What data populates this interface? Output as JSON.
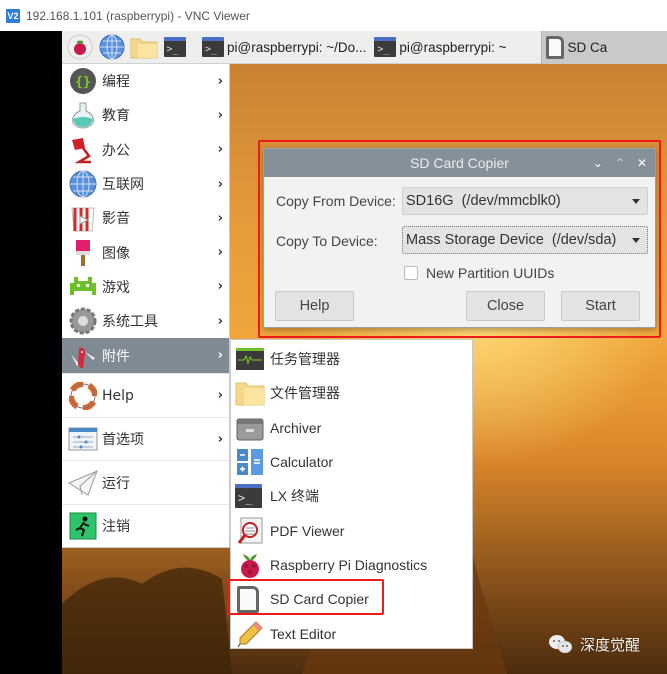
{
  "vnc": {
    "logo": "V2",
    "title": "192.168.1.101 (raspberrypi) - VNC Viewer"
  },
  "taskbar": {
    "launchers": [
      {
        "icon": "raspberry-menu-icon"
      },
      {
        "icon": "web-browser-icon"
      },
      {
        "icon": "file-manager-icon"
      },
      {
        "icon": "terminal-icon"
      }
    ],
    "tasks": [
      {
        "icon": "terminal-icon",
        "label": "pi@raspberrypi: ~/Do..."
      },
      {
        "icon": "terminal-icon",
        "label": "pi@raspberrypi: ~"
      },
      {
        "icon": "sd-card-icon",
        "label": "SD Ca",
        "active": true
      }
    ]
  },
  "main_menu": {
    "items": [
      {
        "label": "编程",
        "icon": "programming-icon",
        "submenu": true
      },
      {
        "label": "教育",
        "icon": "education-icon",
        "submenu": true
      },
      {
        "label": "办公",
        "icon": "office-icon",
        "submenu": true
      },
      {
        "label": "互联网",
        "icon": "internet-icon",
        "submenu": true
      },
      {
        "label": "影音",
        "icon": "media-icon",
        "submenu": true
      },
      {
        "label": "图像",
        "icon": "graphics-icon",
        "submenu": true
      },
      {
        "label": "游戏",
        "icon": "games-icon",
        "submenu": true
      },
      {
        "label": "系统工具",
        "icon": "system-tools-icon",
        "submenu": true
      },
      {
        "label": "附件",
        "icon": "accessories-icon",
        "submenu": true,
        "selected": true
      },
      {
        "label": "Help",
        "icon": "help-icon",
        "submenu": true
      },
      {
        "label": "首选项",
        "icon": "preferences-icon",
        "submenu": true
      },
      {
        "label": "运行",
        "icon": "run-icon",
        "submenu": false
      },
      {
        "label": "注销",
        "icon": "logout-icon",
        "submenu": false
      }
    ],
    "chevron": "›"
  },
  "sub_menu": {
    "items": [
      {
        "label": "任务管理器",
        "icon": "task-manager-icon"
      },
      {
        "label": "文件管理器",
        "icon": "file-manager-icon"
      },
      {
        "label": "Archiver",
        "icon": "archiver-icon"
      },
      {
        "label": "Calculator",
        "icon": "calculator-icon"
      },
      {
        "label": "LX 终端",
        "icon": "terminal-icon"
      },
      {
        "label": "PDF Viewer",
        "icon": "pdf-viewer-icon"
      },
      {
        "label": "Raspberry Pi Diagnostics",
        "icon": "raspberry-icon"
      },
      {
        "label": "SD Card Copier",
        "icon": "sd-card-icon",
        "highlighted": true
      },
      {
        "label": "Text Editor",
        "icon": "text-editor-icon"
      }
    ]
  },
  "dialog": {
    "title": "SD Card Copier",
    "controls": {
      "minimize": "⌄",
      "maximize": "⌃",
      "close": "✕"
    },
    "copy_from_label": "Copy From Device:",
    "copy_from_value": "SD16G  (/dev/mmcblk0)",
    "copy_to_label": "Copy To Device:",
    "copy_to_value": "Mass Storage Device  (/dev/sda)",
    "checkbox_label": "New Partition UUIDs",
    "checkbox_checked": false,
    "buttons": {
      "help": "Help",
      "close": "Close",
      "start": "Start"
    }
  },
  "annotations": {
    "highlight_color": "#ee1b1b"
  },
  "watermark": {
    "text": "深度觉醒",
    "icon": "wechat-icon"
  }
}
